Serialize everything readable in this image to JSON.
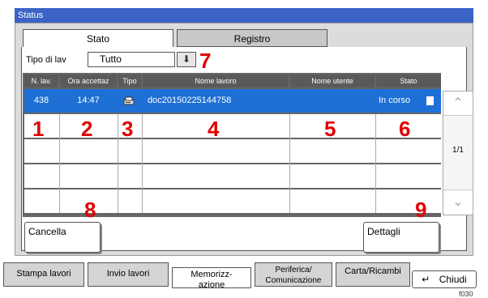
{
  "window": {
    "title": "Status"
  },
  "tabs": [
    {
      "label": "Stato",
      "active": true
    },
    {
      "label": "Registro",
      "active": false
    }
  ],
  "filter": {
    "label": "Tipo di lav",
    "value": "Tutto"
  },
  "table": {
    "columns": [
      "N. lav.",
      "Ora accettaz",
      "Tipo",
      "Nome lavoro",
      "Nome utente",
      "Stato"
    ],
    "rows": [
      {
        "job_no": "438",
        "time": "14:47",
        "type_icon": "print-job-icon",
        "name": "doc20150225144758",
        "user": "",
        "status": "In corso"
      }
    ]
  },
  "pager": {
    "label": "1/1"
  },
  "buttons": {
    "cancel": "Cancella",
    "details": "Dettagli",
    "close": "Chiudi"
  },
  "markers": [
    "1",
    "2",
    "3",
    "4",
    "5",
    "6",
    "7",
    "8",
    "9"
  ],
  "bottom_tabs": [
    {
      "label": "Stampa lavori"
    },
    {
      "label": "Invio lavori"
    },
    {
      "label": "Memorizz-\nazione",
      "active": true
    },
    {
      "label": "Periferica/\nComunicazione"
    },
    {
      "label": "Carta/Ricambi"
    }
  ],
  "footer_code": "f030",
  "colors": {
    "title_bar": "#3b63c6",
    "selected_row": "#1e6fd6",
    "marker": "#e00000"
  }
}
